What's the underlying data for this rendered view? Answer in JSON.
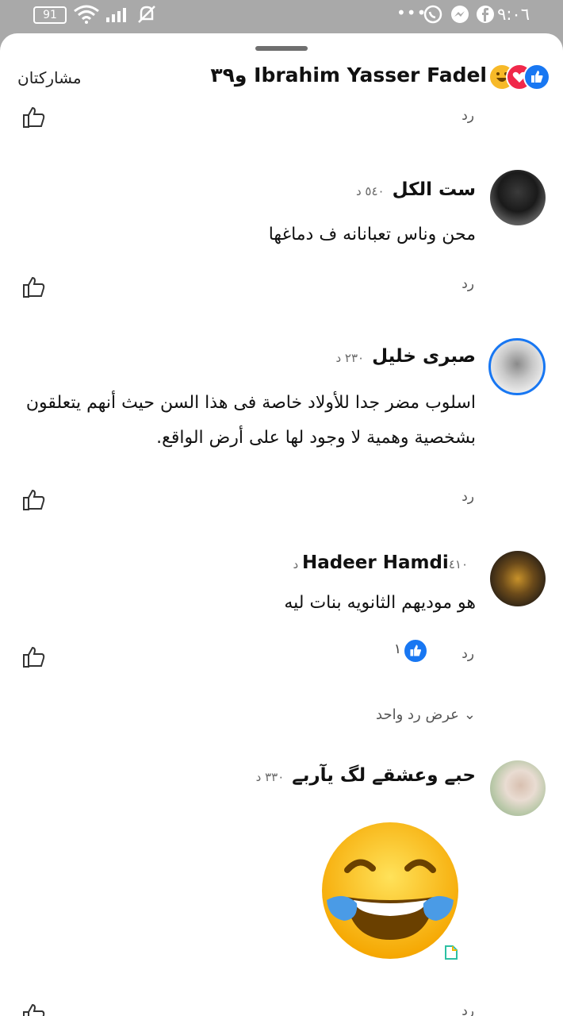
{
  "status_bar": {
    "time": "٩:٠٦",
    "battery": "91",
    "more": "•••"
  },
  "header": {
    "shares_label": "مشاركتان",
    "reactors_text": "Ibrahim Yasser Fadel و٣٩"
  },
  "comments": [
    {
      "name": "ست الكل",
      "time": "٥٤٠ د",
      "text": "محن وناس تعبانانه ف دماغها",
      "reply": "رد"
    },
    {
      "name": "صبرى خليل",
      "time": "٢٣٠ د",
      "text": "اسلوب مضر جدا للأولاد  خاصة فى هذا السن حيث أنهم يتعلقون بشخصية وهمية لا وجود لها على أرض الواقع.",
      "reply": "رد"
    },
    {
      "name": "Hadeer Hamdi",
      "time": "٤١٠ د",
      "text": "هو موديهم الثانويه بنات ليه",
      "reply": "رد",
      "like_count": "١",
      "view_replies": "عرض رد واحد"
    },
    {
      "name": "حبے وعشقے لگ يآربے",
      "time": "٣٣٠ د",
      "reply": "رد"
    }
  ],
  "top_reply": "رد",
  "colors": {
    "like_blue": "#1877f2",
    "love_red": "#f0284a",
    "haha_yellow": "#f7b928"
  }
}
